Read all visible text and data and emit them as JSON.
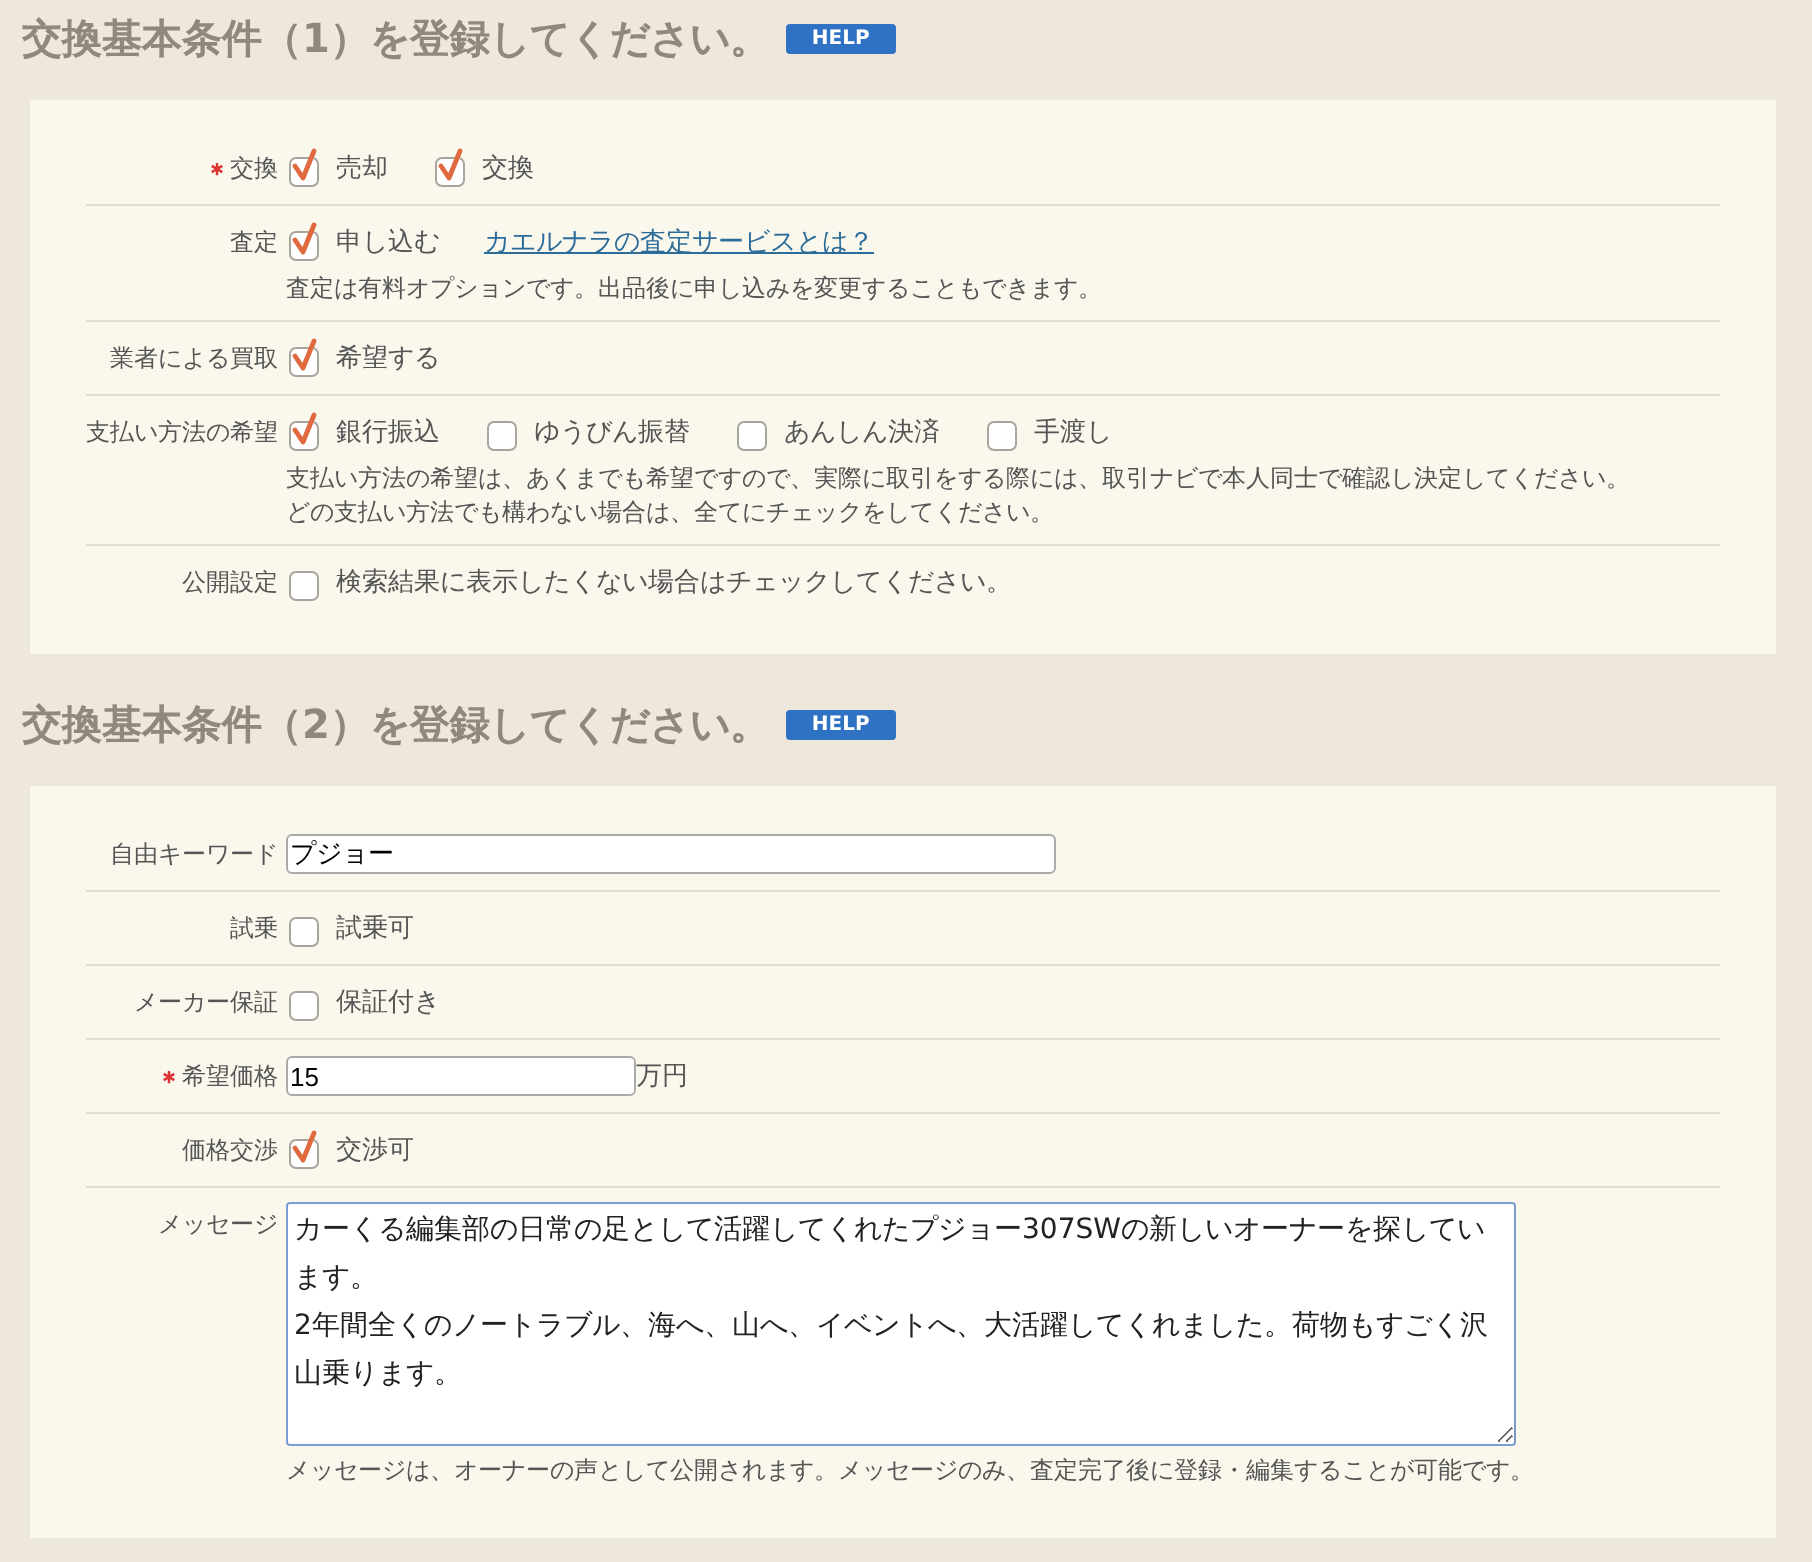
{
  "sections": [
    {
      "title": "交換基本条件（1）を登録してください。",
      "help": "HELP",
      "rows": [
        {
          "kind": "checks",
          "label": "交換",
          "required": true,
          "options": [
            {
              "label": "売却",
              "checked": true
            },
            {
              "label": "交換",
              "checked": true
            }
          ]
        },
        {
          "kind": "checks",
          "label": "査定",
          "required": false,
          "options": [
            {
              "label": "申し込む",
              "checked": true
            }
          ],
          "link": "カエルナラの査定サービスとは？",
          "notes": [
            "査定は有料オプションです。出品後に申し込みを変更することもできます。"
          ]
        },
        {
          "kind": "checks",
          "label": "業者による買取",
          "required": false,
          "options": [
            {
              "label": "希望する",
              "checked": true
            }
          ]
        },
        {
          "kind": "checks",
          "label": "支払い方法の希望",
          "required": false,
          "options": [
            {
              "label": "銀行振込",
              "checked": true
            },
            {
              "label": "ゆうびん振替",
              "checked": false
            },
            {
              "label": "あんしん決済",
              "checked": false
            },
            {
              "label": "手渡し",
              "checked": false
            }
          ],
          "notes": [
            "支払い方法の希望は、あくまでも希望ですので、実際に取引をする際には、取引ナビで本人同士で確認し決定してください。",
            "どの支払い方法でも構わない場合は、全てにチェックをしてください。"
          ]
        },
        {
          "kind": "checks",
          "label": "公開設定",
          "required": false,
          "options": [
            {
              "label": "検索結果に表示したくない場合はチェックしてください。",
              "checked": false
            }
          ]
        }
      ]
    },
    {
      "title": "交換基本条件（2）を登録してください。",
      "help": "HELP",
      "rows": [
        {
          "kind": "text",
          "label": "自由キーワード",
          "required": false,
          "value": "プジョー"
        },
        {
          "kind": "checks",
          "label": "試乗",
          "required": false,
          "options": [
            {
              "label": "試乗可",
              "checked": false
            }
          ]
        },
        {
          "kind": "checks",
          "label": "メーカー保証",
          "required": false,
          "options": [
            {
              "label": "保証付き",
              "checked": false
            }
          ]
        },
        {
          "kind": "text",
          "label": "希望価格",
          "required": true,
          "value": "15",
          "unit": "万円"
        },
        {
          "kind": "checks",
          "label": "価格交渉",
          "required": false,
          "options": [
            {
              "label": "交渉可",
              "checked": true
            }
          ]
        },
        {
          "kind": "textarea",
          "label": "メッセージ",
          "required": false,
          "value": "カーくる編集部の日常の足として活躍してくれたプジョー307SWの新しいオーナーを探しています。\n2年間全くのノートラブル、海へ、山へ、イベントへ、大活躍してくれました。荷物もすごく沢山乗ります。",
          "notes": [
            "メッセージは、オーナーの声として公開されます。メッセージのみ、査定完了後に登録・編集することが可能です。"
          ]
        }
      ]
    }
  ]
}
